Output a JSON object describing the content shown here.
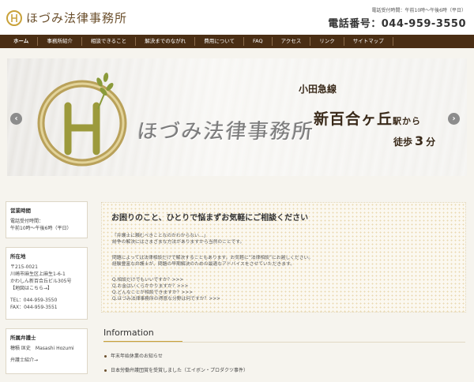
{
  "header": {
    "logo_text": "ほづみ法律事務所",
    "tel_hours": "電話受付時間：午前10時～午後6時（平日）",
    "tel_number": "電話番号：044-959-3550"
  },
  "nav": [
    {
      "label": "ホーム"
    },
    {
      "label": "事務所紹介"
    },
    {
      "label": "相談できること"
    },
    {
      "label": "解決までのながれ"
    },
    {
      "label": "費用について"
    },
    {
      "label": "FAQ"
    },
    {
      "label": "アクセス"
    },
    {
      "label": "リンク"
    },
    {
      "label": "サイトマップ"
    }
  ],
  "hero": {
    "sign_text": "ほづみ法律事務所",
    "line1": "小田急線",
    "line2_main": "新百合ヶ丘",
    "line2_suffix": "駅から",
    "line3_prefix": "徒歩",
    "line3_num": "3",
    "line3_suffix": "分",
    "prev_glyph": "‹",
    "next_glyph": "›"
  },
  "sidebar": {
    "hours": {
      "title": "営業時間",
      "line1": "電話受付時間：",
      "line2": "午前10時～午後6時（平日）"
    },
    "address": {
      "title": "所在地",
      "lines": [
        "〒215-0021",
        "川崎市麻生区上麻生1-6-1",
        "かわしん新百合丘ビル305号",
        "【地図はこちら→】"
      ],
      "tel": "TEL：044-959-3550",
      "fax": "FAX：044-959-3551"
    },
    "lawyer": {
      "title": "所属弁護士",
      "name": "穂積 匡史　Masashi Hozumi",
      "link": "弁護士紹介→"
    }
  },
  "main": {
    "heading": "お困りのこと、ひとりで悩まずお気軽にご相談ください",
    "para1_line1": "「弁護士に頼むべきことなのかわからない…」",
    "para1_line2": "紛争の解決にはさまざまな方法がありますから当然のことです。",
    "para2_line1": "問題によっては法律相談だけで解決することもあります。お気軽に“法律相談”にお越しください。",
    "para2_line2": "経験豊富な弁護士が、問題の早期解決のための最適なアドバイスをさせていただきます。",
    "questions": [
      "Q.相談だけでもいいですか？>>>",
      "Q.お金はいくらかかりますか？>>>",
      "Q.どんなことが相談できますか？>>>",
      "Q.ほづみ法律事務所の得意な分野は何ですか？>>>"
    ]
  },
  "information": {
    "title": "Information",
    "items": [
      "年末年始休業のお知らせ",
      "日本労働弁護団賞を受賞しました（エイボン・プロダクツ事件）"
    ]
  },
  "colors": {
    "nav_bg": "#4a2e14",
    "accent_gold": "#c9a23a",
    "logo_brown": "#6b4f2c"
  }
}
